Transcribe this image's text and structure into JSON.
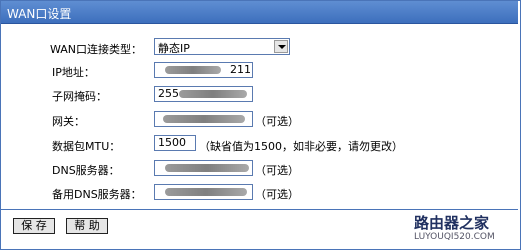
{
  "title": "WAN口设置",
  "wan_type": {
    "label": "WAN口连接类型：",
    "value": "静态IP"
  },
  "ip": {
    "label": "IP地址：",
    "value_suffix": "211"
  },
  "mask": {
    "label": "子网掩码：",
    "value_prefix": "255"
  },
  "gateway": {
    "label": "网关：",
    "note": "（可选）"
  },
  "mtu": {
    "label": "数据包MTU：",
    "value": "1500",
    "note": "（缺省值为1500，如非必要，请勿更改）"
  },
  "dns": {
    "label": "DNS服务器：",
    "note": "（可选）"
  },
  "dns_backup": {
    "label": "备用DNS服务器：",
    "note": "（可选）"
  },
  "buttons": {
    "save": "保 存",
    "help": "帮 助"
  },
  "brand": {
    "name": "路由器之家",
    "url": "LUYOUQI520.COM"
  }
}
